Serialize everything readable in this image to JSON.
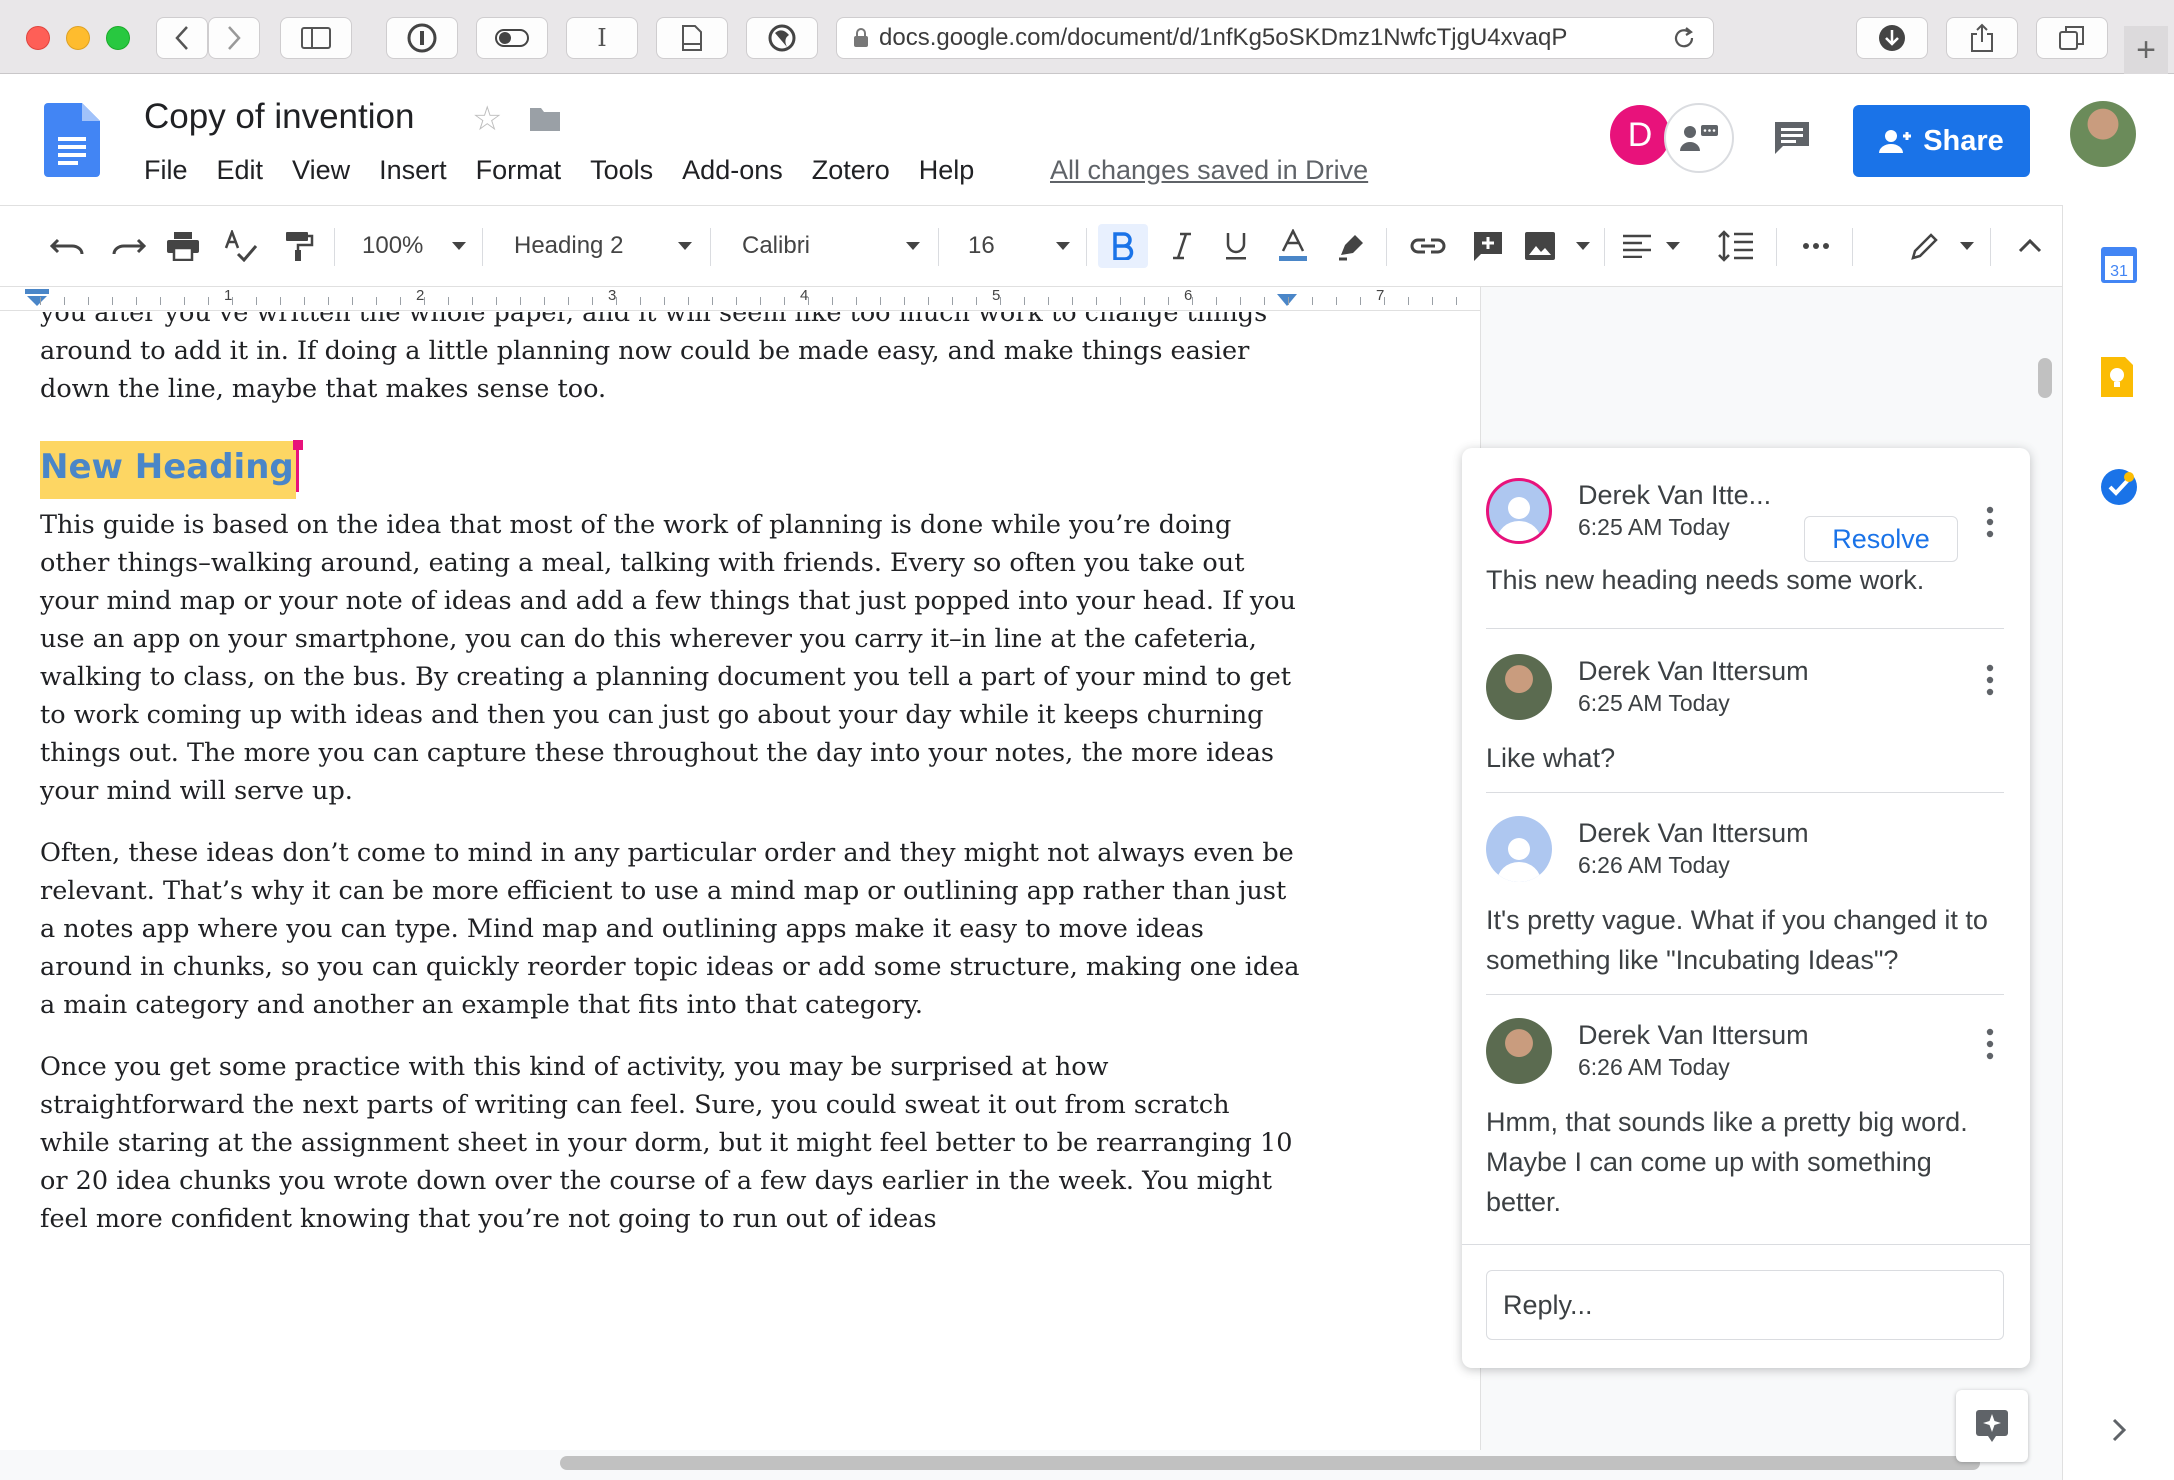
{
  "browser": {
    "url": "docs.google.com/document/d/1nfKg5oSKDmz1NwfcTjgU4xvaqP"
  },
  "doc": {
    "title": "Copy of invention",
    "saved_status": "All changes saved in Drive",
    "menu": [
      "File",
      "Edit",
      "View",
      "Insert",
      "Format",
      "Tools",
      "Add-ons",
      "Zotero",
      "Help"
    ],
    "share_label": "Share",
    "avatar_initial": "D"
  },
  "toolbar": {
    "zoom": "100%",
    "style": "Heading 2",
    "font": "Calibri",
    "size": "16"
  },
  "ruler": [
    "1",
    "2",
    "3",
    "4",
    "5",
    "6",
    "7"
  ],
  "content": {
    "para_top": "you after you’ve written the whole paper, and it will seem like too much work to change things around to add it in. If doing a little planning now could be made easy, and make things easier down the line, maybe that makes sense too.",
    "heading": "New Heading",
    "para1": "This guide is based on the idea that most of the work of planning is done while you’re doing other things–walking around, eating a meal, talking with friends. Every so often you take out your mind map or your note of ideas and add a few things that just popped into your head. If you use an app on your smartphone, you can do this wherever you carry it–in line at the cafeteria, walking to class, on the bus. By creating a planning document you tell a part of your mind to get to work coming up with ideas and then you can just go about your day while it keeps churning things out. The more you can capture these throughout the day into your notes, the more ideas your mind will serve up.",
    "para2": "Often, these ideas don’t come to mind in any particular order and they might not always even be relevant. That’s why it can be more efficient to use a mind map or outlining app rather than just a notes app where you can type. Mind map and outlining apps make it easy to move ideas around in chunks, so you can quickly reorder topic ideas or add some structure, making one idea a main category and another an example that fits into that category.",
    "para3": "Once you get some practice with this kind of activity, you may be surprised at how straightforward the next parts of writing can feel. Sure, you could sweat it out from scratch while staring at the assignment sheet in your dorm, but it might feel better to be rearranging 10 or 20 idea chunks you wrote down over the course of a few days earlier in the week. You might feel more confident knowing that you’re not going to run out of ideas"
  },
  "comments": {
    "resolve_label": "Resolve",
    "reply_placeholder": "Reply...",
    "items": [
      {
        "name": "Derek Van Itte...",
        "time": "6:25 AM Today",
        "text": "This new heading needs some work."
      },
      {
        "name": "Derek Van Ittersum",
        "time": "6:25 AM Today",
        "text": "Like what?"
      },
      {
        "name": "Derek Van Ittersum",
        "time": "6:26 AM Today",
        "text": "It's pretty vague. What if you changed it to something like \"Incubating Ideas\"?"
      },
      {
        "name": "Derek Van Ittersum",
        "time": "6:26 AM Today",
        "text": "Hmm, that sounds like a pretty big word. Maybe I can come up with something better."
      }
    ]
  },
  "side_panel": {
    "calendar_day": "31"
  },
  "colors": {
    "accent": "#1a73e8",
    "heading": "#4a86c8",
    "highlight": "#fdd663",
    "collaborator": "#e8127b"
  }
}
